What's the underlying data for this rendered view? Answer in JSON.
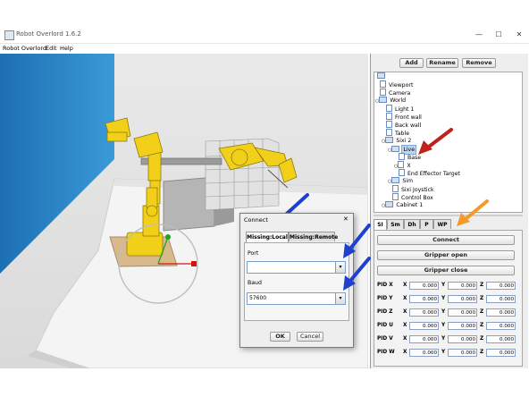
{
  "window": {
    "title": "Robot Overlord 1.6.2",
    "minimize": "—",
    "maximize": "☐",
    "close": "✕"
  },
  "menu": [
    "Robot Overlord",
    "Edit",
    "Help"
  ],
  "toolbar": {
    "add": "Add",
    "rename": "Rename",
    "remove": "Remove"
  },
  "tree": [
    {
      "label": "Viewport"
    },
    {
      "label": "Camera"
    },
    {
      "label": "World"
    },
    {
      "label": "Light 1"
    },
    {
      "label": "Front wall"
    },
    {
      "label": "Back wall"
    },
    {
      "label": "Table"
    },
    {
      "label": "Sixi 2"
    },
    {
      "label": "Live"
    },
    {
      "label": "Base"
    },
    {
      "label": "X"
    },
    {
      "label": "End Effector Target"
    },
    {
      "label": "Sim"
    },
    {
      "label": "Sixi Joystick"
    },
    {
      "label": "Control Box"
    },
    {
      "label": "Cabinet 1"
    }
  ],
  "panel_tabs": [
    "SI",
    "Sm",
    "Dh",
    "P",
    "WP"
  ],
  "panel": {
    "connect": "Connect",
    "gripper_open": "Gripper open",
    "gripper_close": "Gripper close"
  },
  "pid": {
    "axes": [
      "X",
      "Y",
      "Z"
    ],
    "rows": [
      {
        "label": "PID X",
        "values": [
          "0.000",
          "0.000",
          "0.000"
        ]
      },
      {
        "label": "PID Y",
        "values": [
          "0.000",
          "0.000",
          "0.000"
        ]
      },
      {
        "label": "PID Z",
        "values": [
          "0.000",
          "0.000",
          "0.000"
        ]
      },
      {
        "label": "PID U",
        "values": [
          "0.000",
          "0.000",
          "0.000"
        ]
      },
      {
        "label": "PID V",
        "values": [
          "0.000",
          "0.000",
          "0.000"
        ]
      },
      {
        "label": "PID W",
        "values": [
          "0.000",
          "0.000",
          "0.000"
        ]
      }
    ]
  },
  "dialog": {
    "title": "Connect",
    "close": "✕",
    "tabs": [
      "Missing:Local",
      "Missing:Remote"
    ],
    "port_label": "Port",
    "port_value": "",
    "baud_label": "Baud",
    "baud_value": "57600",
    "ok": "OK",
    "cancel": "Cancel"
  },
  "icons": {
    "dropdown": "chevron-down-icon",
    "annotation": "arrow-icon"
  },
  "colors": {
    "arrow_blue": "#1f3fd1",
    "arrow_red": "#c0211b",
    "arrow_orange": "#f39a2a",
    "wall_blue": "#2b86c6",
    "robot_yellow": "#f2d01a"
  }
}
